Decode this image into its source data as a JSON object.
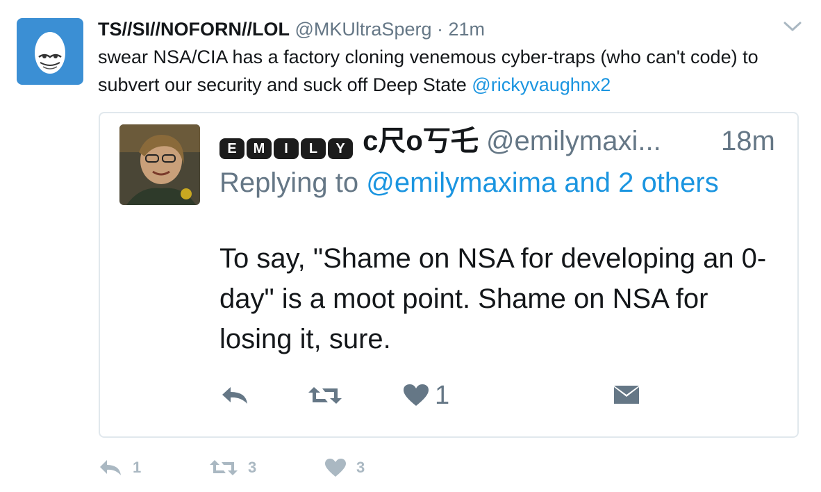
{
  "tweet": {
    "display_name": "TS//SI//NOFORN//LOL",
    "handle": "@MKUltraSperg",
    "separator": "·",
    "time": "21m",
    "text_main": "swear NSA/CIA has a factory cloning venemous cyber-traps (who can't code) to subvert our security and suck off Deep State ",
    "text_mention": "@rickyvaughnx2",
    "avatar_icon": "egg-avatar-icon",
    "caret_icon": "chevron-down-icon",
    "colors": {
      "accent": "#1b95e0",
      "muted": "#657786",
      "avatar_bg": "#3b8fd4"
    }
  },
  "quote": {
    "name_letters": [
      "E",
      "M",
      "I",
      "L",
      "Y"
    ],
    "name_rest": "c尺o丂乇",
    "handle": "@emilymaxi...",
    "time": "18m",
    "reply_prefix": "Replying to ",
    "reply_mentions": "@emilymaxima and 2 others",
    "text": "To say, \"Shame on NSA for developing an 0-day\" is a moot point. Shame on NSA for losing it, sure.",
    "like_count": "1"
  },
  "actions": {
    "reply_count": "1",
    "retweet_count": "3",
    "like_count": "3"
  }
}
